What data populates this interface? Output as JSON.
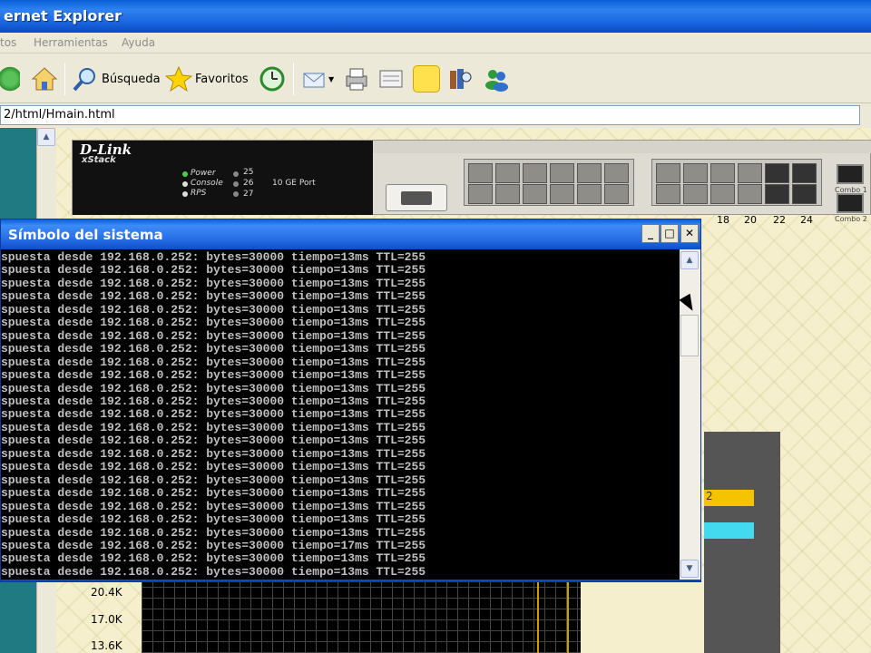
{
  "browser": {
    "title": "ernet Explorer",
    "menu": [
      "tos",
      "Herramientas",
      "Ayuda"
    ],
    "toolbar": {
      "search_label": "Búsqueda",
      "favorites_label": "Favoritos"
    },
    "address": "2/html/Hmain.html"
  },
  "switch": {
    "brand": "D-Link",
    "series": "xStack",
    "leds": [
      "Power",
      "Console",
      "RPS"
    ],
    "port_ids": [
      "25",
      "26",
      "27"
    ],
    "ge_label": "10 GE Port",
    "port_numbers": [
      "18",
      "20",
      "22",
      "24"
    ],
    "combo_labels": [
      "Combo 1",
      "Combo 2"
    ]
  },
  "monitor": {
    "yellow_value": "2",
    "y_ticks": [
      "20.4K",
      "17.0K",
      "13.6K"
    ]
  },
  "cmd": {
    "title": "Símbolo del sistema",
    "lines": [
      "spuesta desde 192.168.0.252: bytes=30000 tiempo=13ms TTL=255",
      "spuesta desde 192.168.0.252: bytes=30000 tiempo=13ms TTL=255",
      "spuesta desde 192.168.0.252: bytes=30000 tiempo=13ms TTL=255",
      "spuesta desde 192.168.0.252: bytes=30000 tiempo=13ms TTL=255",
      "spuesta desde 192.168.0.252: bytes=30000 tiempo=13ms TTL=255",
      "spuesta desde 192.168.0.252: bytes=30000 tiempo=13ms TTL=255",
      "spuesta desde 192.168.0.252: bytes=30000 tiempo=13ms TTL=255",
      "spuesta desde 192.168.0.252: bytes=30000 tiempo=13ms TTL=255",
      "spuesta desde 192.168.0.252: bytes=30000 tiempo=13ms TTL=255",
      "spuesta desde 192.168.0.252: bytes=30000 tiempo=13ms TTL=255",
      "spuesta desde 192.168.0.252: bytes=30000 tiempo=13ms TTL=255",
      "spuesta desde 192.168.0.252: bytes=30000 tiempo=13ms TTL=255",
      "spuesta desde 192.168.0.252: bytes=30000 tiempo=13ms TTL=255",
      "spuesta desde 192.168.0.252: bytes=30000 tiempo=13ms TTL=255",
      "spuesta desde 192.168.0.252: bytes=30000 tiempo=13ms TTL=255",
      "spuesta desde 192.168.0.252: bytes=30000 tiempo=13ms TTL=255",
      "spuesta desde 192.168.0.252: bytes=30000 tiempo=13ms TTL=255",
      "spuesta desde 192.168.0.252: bytes=30000 tiempo=13ms TTL=255",
      "spuesta desde 192.168.0.252: bytes=30000 tiempo=13ms TTL=255",
      "spuesta desde 192.168.0.252: bytes=30000 tiempo=13ms TTL=255",
      "spuesta desde 192.168.0.252: bytes=30000 tiempo=13ms TTL=255",
      "spuesta desde 192.168.0.252: bytes=30000 tiempo=13ms TTL=255",
      "spuesta desde 192.168.0.252: bytes=30000 tiempo=17ms TTL=255",
      "spuesta desde 192.168.0.252: bytes=30000 tiempo=13ms TTL=255",
      "spuesta desde 192.168.0.252: bytes=30000 tiempo=13ms TTL=255"
    ]
  }
}
